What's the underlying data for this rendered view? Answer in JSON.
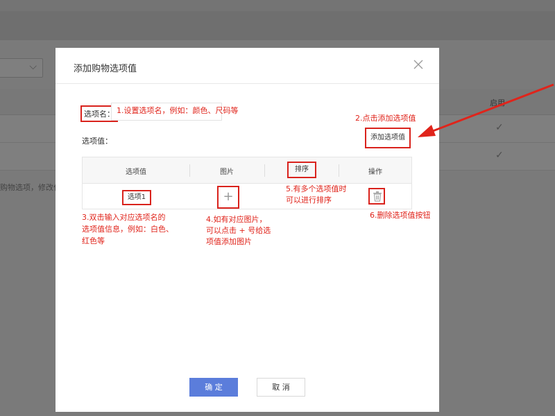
{
  "modal": {
    "title": "添加购物选项值",
    "option_name_label": "选项名：",
    "option_value_label": "选项值：",
    "add_button": "添加选项值",
    "table": {
      "headers": [
        "选项值",
        "图片",
        "排序",
        "操作"
      ],
      "rows": [
        {
          "option": "选项1",
          "image": "+"
        }
      ]
    },
    "confirm_button": "确 定",
    "cancel_button": "取 消"
  },
  "annotations": {
    "a1": "1.设置选项名，例如：颜色、尺码等",
    "a2": "2.点击添加选项值",
    "a3_lines": [
      "3.双击输入对应选项名的",
      "选项值信息，例如：白色、",
      "红色等"
    ],
    "a4_lines": [
      "4.如有对应图片，",
      "可以点击 + 号给选",
      "项值添加图片"
    ],
    "a5_lines": [
      "5.有多个选项值时",
      "可以进行排序"
    ],
    "a6": "6.删除选项值按钮"
  },
  "background": {
    "column_label": "启用",
    "check_mark": "✓",
    "note_fragment": "购物选项，修改仅",
    "chevron": "⌵"
  },
  "colors": {
    "annotation_red": "#e0241b",
    "primary_button": "#5b7ddb"
  }
}
